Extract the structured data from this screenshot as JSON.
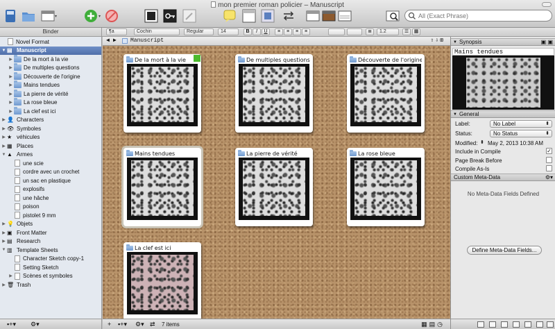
{
  "window": {
    "title": "mon premier roman policier – Manuscript"
  },
  "toolbar": {
    "search_placeholder": "All (Exact Phrase)"
  },
  "format_bar": {
    "binder_label": "Binder",
    "style_value": "¶a",
    "font_family": "Cochin",
    "font_style": "Regular",
    "font_size": "14",
    "line_spacing": "1.2"
  },
  "binder": {
    "items": [
      {
        "label": "Novel Format",
        "level": 0,
        "icon": "doc-icon",
        "tri": ""
      },
      {
        "label": "Manuscript",
        "level": 0,
        "icon": "manuscript-icon",
        "tri": "▼",
        "selected": true
      },
      {
        "label": "De la mort à la vie",
        "level": 1,
        "icon": "folder-icon",
        "tri": "▶"
      },
      {
        "label": "De multiples questions",
        "level": 1,
        "icon": "folder-icon",
        "tri": "▶"
      },
      {
        "label": "Découverte de l'origine",
        "level": 1,
        "icon": "folder-icon",
        "tri": "▶"
      },
      {
        "label": "Mains tendues",
        "level": 1,
        "icon": "folder-icon",
        "tri": "▶"
      },
      {
        "label": "La pierre de vérité",
        "level": 1,
        "icon": "folder-icon",
        "tri": "▶"
      },
      {
        "label": "La rose bleue",
        "level": 1,
        "icon": "folder-icon",
        "tri": "▶"
      },
      {
        "label": "La clef est ici",
        "level": 1,
        "icon": "folder-icon",
        "tri": "▶"
      },
      {
        "label": "Characters",
        "level": 0,
        "icon": "characters-icon",
        "tri": "▶"
      },
      {
        "label": "Symboles",
        "level": 0,
        "icon": "eye-icon",
        "tri": "▶"
      },
      {
        "label": "véhicules",
        "level": 0,
        "icon": "star-icon",
        "tri": "▶"
      },
      {
        "label": "Places",
        "level": 0,
        "icon": "places-icon",
        "tri": "▶"
      },
      {
        "label": "Armes",
        "level": 0,
        "icon": "warning-icon",
        "tri": "▼"
      },
      {
        "label": "une scie",
        "level": 1,
        "icon": "doc-icon",
        "tri": ""
      },
      {
        "label": "cordre avec un crochet",
        "level": 1,
        "icon": "doc-icon",
        "tri": ""
      },
      {
        "label": "un sac en plastique",
        "level": 1,
        "icon": "doc-icon",
        "tri": ""
      },
      {
        "label": "explosifs",
        "level": 1,
        "icon": "doc-icon",
        "tri": ""
      },
      {
        "label": "une hâche",
        "level": 1,
        "icon": "doc-icon",
        "tri": ""
      },
      {
        "label": "poison",
        "level": 1,
        "icon": "doc-icon",
        "tri": ""
      },
      {
        "label": "pistolet 9 mm",
        "level": 1,
        "icon": "doc-icon",
        "tri": ""
      },
      {
        "label": "Objets",
        "level": 0,
        "icon": "bulb-icon",
        "tri": "▶"
      },
      {
        "label": "Front Matter",
        "level": 0,
        "icon": "front-matter-icon",
        "tri": "▶"
      },
      {
        "label": "Research",
        "level": 0,
        "icon": "research-icon",
        "tri": "▶"
      },
      {
        "label": "Template Sheets",
        "level": 0,
        "icon": "template-icon",
        "tri": "▼"
      },
      {
        "label": "Character Sketch copy-1",
        "level": 1,
        "icon": "doc-icon",
        "tri": ""
      },
      {
        "label": "Setting Sketch",
        "level": 1,
        "icon": "doc-icon",
        "tri": ""
      },
      {
        "label": "Scènes et symboles",
        "level": 1,
        "icon": "doc-icon",
        "tri": "▶"
      },
      {
        "label": "Trash",
        "level": 0,
        "icon": "trash-icon",
        "tri": "▶"
      }
    ]
  },
  "main": {
    "path_title": "Manuscript",
    "item_count": "7 items",
    "cards": [
      {
        "title": "De la mort à la vie",
        "label_color": "#4cba2c"
      },
      {
        "title": "De multiples questions"
      },
      {
        "title": "Découverte de l'origine"
      },
      {
        "title": "Mains tendues",
        "highlight": true
      },
      {
        "title": "La pierre de vérité"
      },
      {
        "title": "La rose bleue"
      },
      {
        "title": "La clef est ici"
      }
    ]
  },
  "inspector": {
    "synopsis_header": "Synopsis",
    "synopsis_title": "Mains tendues",
    "general_header": "General",
    "label_label": "Label:",
    "label_value": "No Label",
    "status_label": "Status:",
    "status_value": "No Status",
    "modified_label": "Modified:",
    "modified_value": "May 2, 2013 10:38 AM",
    "include_label": "Include in Compile",
    "pagebreak_label": "Page Break Before",
    "compileas_label": "Compile As-Is",
    "meta_header": "Custom Meta-Data",
    "meta_empty": "No Meta-Data Fields Defined",
    "define_button": "Define Meta-Data Fields..."
  },
  "colors": {
    "selection": "#5675b0",
    "label_green": "#4cba2c"
  }
}
